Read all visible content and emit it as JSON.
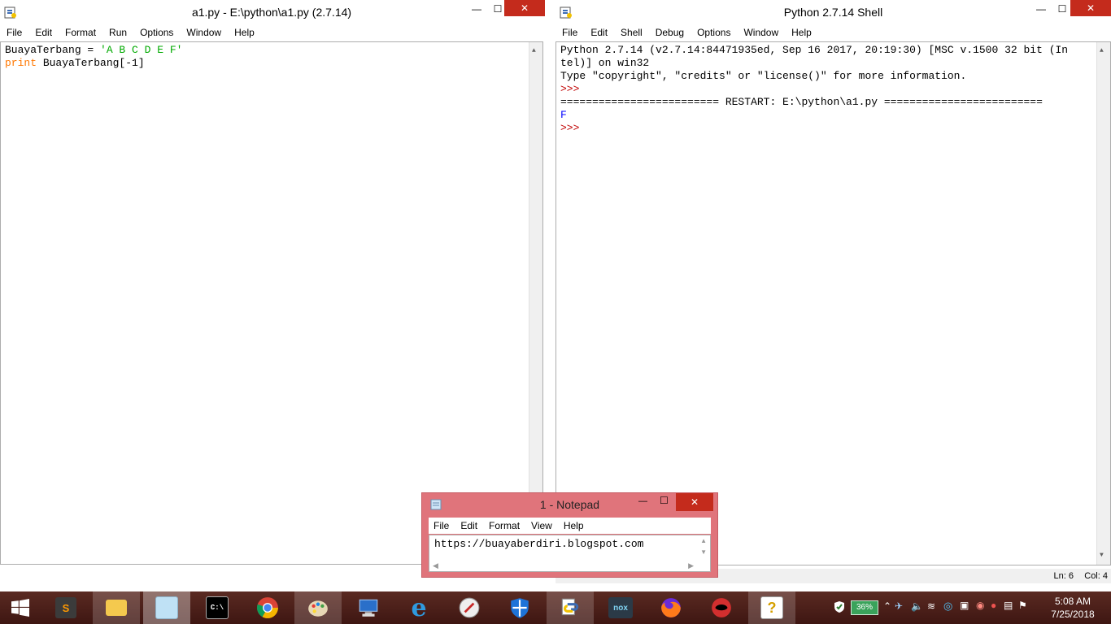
{
  "left_window": {
    "title": "a1.py - E:\\python\\a1.py (2.7.14)",
    "menu": [
      "File",
      "Edit",
      "Format",
      "Run",
      "Options",
      "Window",
      "Help"
    ],
    "code": {
      "line1_var": "BuayaTerbang = ",
      "line1_str": "'A B C D E F'",
      "line2_kw": "print",
      "line2_rest": " BuayaTerbang[-1]"
    },
    "minimize": "—",
    "maximize": "☐",
    "close": "✕"
  },
  "right_window": {
    "title": "Python 2.7.14 Shell",
    "menu": [
      "File",
      "Edit",
      "Shell",
      "Debug",
      "Options",
      "Window",
      "Help"
    ],
    "lines": {
      "l1": "Python 2.7.14 (v2.7.14:84471935ed, Sep 16 2017, 20:19:30) [MSC v.1500 32 bit (In",
      "l2": "tel)] on win32",
      "l3": "Type \"copyright\", \"credits\" or \"license()\" for more information.",
      "p1": ">>>",
      "restart": "========================= RESTART: E:\\python\\a1.py =========================",
      "output": "F",
      "p2": ">>>"
    },
    "status": {
      "ln": "Ln: 6",
      "col": "Col: 4"
    },
    "minimize": "—",
    "maximize": "☐",
    "close": "✕"
  },
  "notepad": {
    "title": "1 - Notepad",
    "menu": [
      "File",
      "Edit",
      "Format",
      "View",
      "Help"
    ],
    "content": "https://buayaberdiri.blogspot.com",
    "minimize": "—",
    "maximize": "☐",
    "close": "✕"
  },
  "taskbar": {
    "items": [
      {
        "name": "start",
        "icon": "windows-logo-icon"
      },
      {
        "name": "sublime",
        "icon": "sublime-text-icon",
        "glyph": "S"
      },
      {
        "name": "file-explorer",
        "icon": "folder-icon"
      },
      {
        "name": "notepad",
        "icon": "notepad-icon"
      },
      {
        "name": "cmd",
        "icon": "command-prompt-icon",
        "glyph": "C:\\"
      },
      {
        "name": "chrome",
        "icon": "chrome-icon"
      },
      {
        "name": "paint",
        "icon": "paint-palette-icon"
      },
      {
        "name": "remote",
        "icon": "computer-icon"
      },
      {
        "name": "ie",
        "icon": "internet-explorer-icon",
        "glyph": "e"
      },
      {
        "name": "compass",
        "icon": "compass-icon"
      },
      {
        "name": "defender",
        "icon": "shield-icon"
      },
      {
        "name": "python",
        "icon": "python-icon"
      },
      {
        "name": "nox",
        "icon": "nox-icon",
        "glyph": "nox"
      },
      {
        "name": "firefox",
        "icon": "firefox-icon"
      },
      {
        "name": "garena",
        "icon": "garena-icon"
      },
      {
        "name": "help",
        "icon": "help-icon",
        "glyph": "?"
      }
    ],
    "battery": "36%",
    "time": "5:08 AM",
    "date": "7/25/2018"
  },
  "colors": {
    "keyword": "#ff7700",
    "string": "#00aa00",
    "prompt": "#c00000",
    "output": "#0000ff",
    "taskbar": "#4a1d18",
    "notepad_frame": "#e0747b"
  }
}
